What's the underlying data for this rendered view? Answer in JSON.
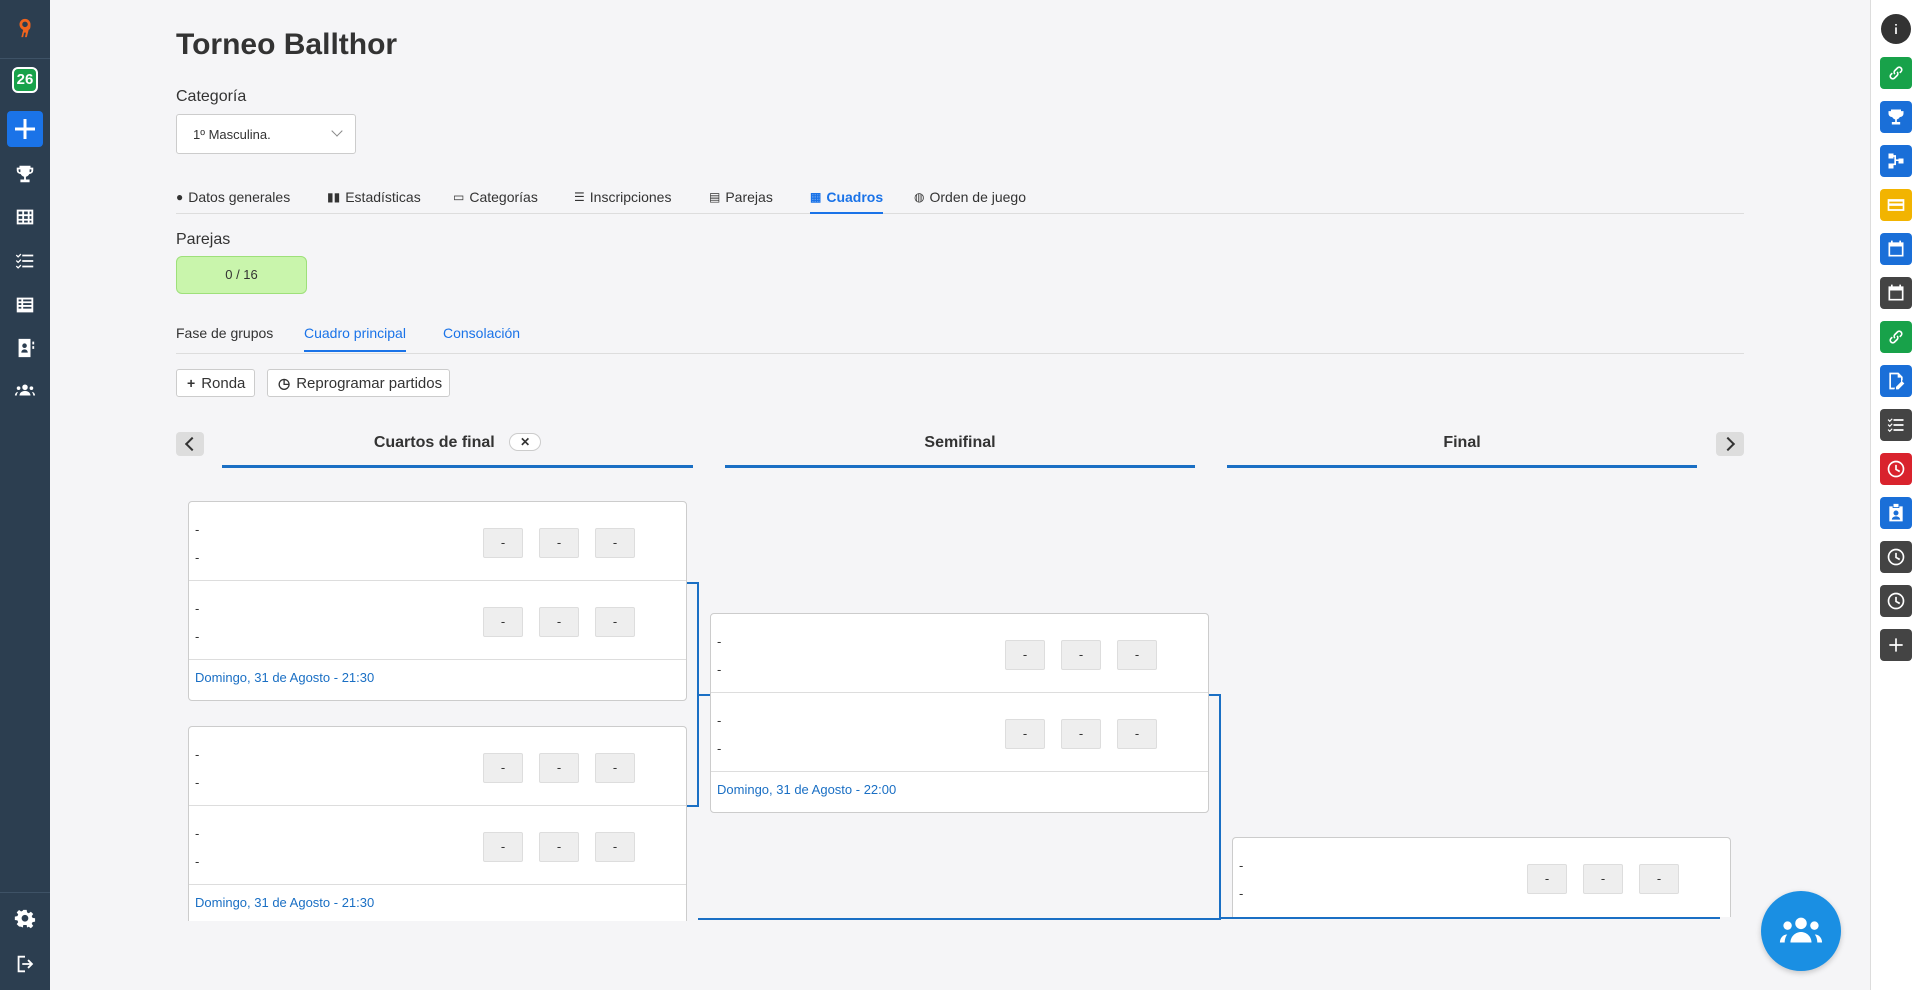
{
  "sidebar": {
    "badge": "26"
  },
  "page": {
    "title": "Torneo Ballthor",
    "category_label": "Categoría",
    "category_value": "1º Masculina."
  },
  "tabs": [
    {
      "label": "Datos generales",
      "icon": "info-icon"
    },
    {
      "label": "Estadísticas",
      "icon": "bar-chart-icon"
    },
    {
      "label": "Categorías",
      "icon": "tag-icon"
    },
    {
      "label": "Inscripciones",
      "icon": "list-icon"
    },
    {
      "label": "Parejas",
      "icon": "document-icon"
    },
    {
      "label": "Cuadros",
      "icon": "grid-icon"
    },
    {
      "label": "Orden de juego",
      "icon": "globe-icon"
    }
  ],
  "parejas": {
    "label": "Parejas",
    "count": "0 / 16"
  },
  "subtabs": [
    "Fase de grupos",
    "Cuadro principal",
    "Consolación"
  ],
  "actions": {
    "ronda": "Ronda",
    "reprogramar": "Reprogramar partidos"
  },
  "rounds": {
    "quarter": "Cuartos de final",
    "quarter_close": "✕",
    "semi": "Semifinal",
    "final": "Final"
  },
  "placeholder": "-",
  "matches": {
    "qf1_date": "Domingo, 31 de Agosto - 21:30",
    "qf2_date": "Domingo, 31 de Agosto - 21:30",
    "sf1_date": "Domingo, 31 de Agosto - 22:00"
  },
  "colors": {
    "accent": "#1a73e8",
    "bracket_line": "#1a6fc4",
    "sidebar": "#2c3e50",
    "pill": "#c9f5ac"
  }
}
